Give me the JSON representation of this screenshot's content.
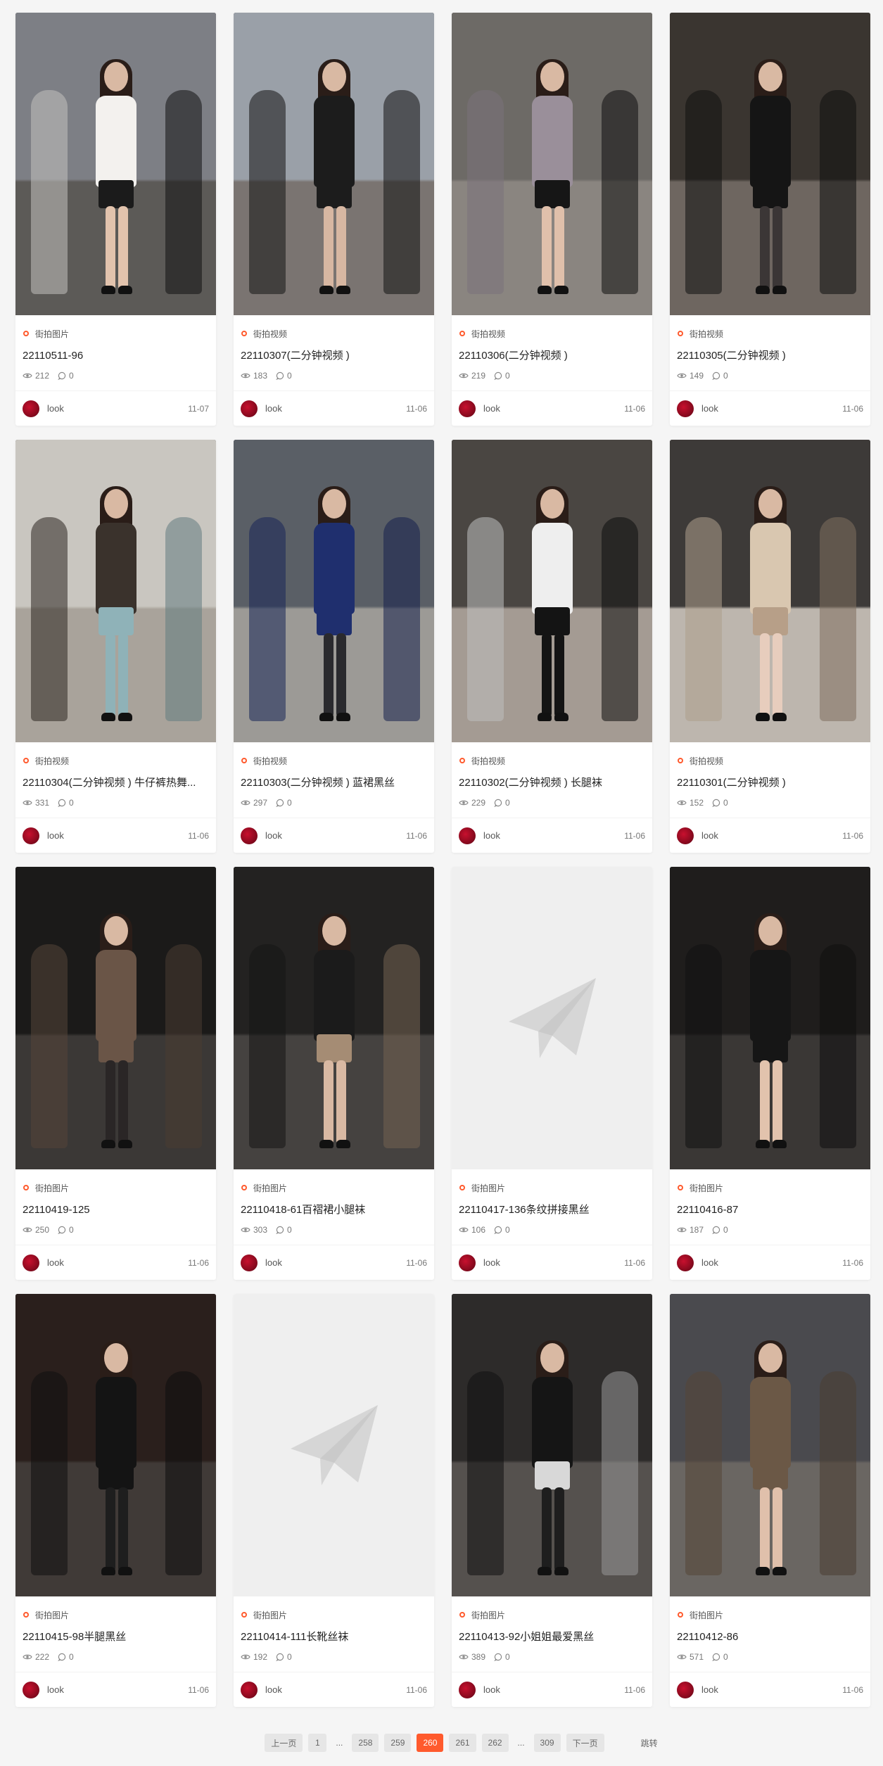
{
  "cards": [
    {
      "category": "街拍图片",
      "title": "22110511-96",
      "views": "212",
      "comments": "0",
      "author": "look",
      "date": "11-07",
      "placeholder": false,
      "palette": {
        "bg": "#7d7f85",
        "ground": "#5c5a57",
        "top": "#f3f1ee",
        "skirt": "#1b1b1b",
        "leg": "#e2c3ad"
      }
    },
    {
      "category": "街拍视频",
      "title": "22110307(二分钟视频 )",
      "views": "183",
      "comments": "0",
      "author": "look",
      "date": "11-06",
      "placeholder": false,
      "palette": {
        "bg": "#9aa0a8",
        "ground": "#7a7471",
        "top": "#1c1c1c",
        "skirt": "#1c1c1c",
        "leg": "#d7b7a2"
      }
    },
    {
      "category": "街拍视频",
      "title": "22110306(二分钟视频 )",
      "views": "219",
      "comments": "0",
      "author": "look",
      "date": "11-06",
      "placeholder": false,
      "palette": {
        "bg": "#6d6a66",
        "ground": "#8a8580",
        "top": "#9a8f9a",
        "skirt": "#161616",
        "leg": "#e0c0ab"
      }
    },
    {
      "category": "街拍视频",
      "title": "22110305(二分钟视频 )",
      "views": "149",
      "comments": "0",
      "author": "look",
      "date": "11-06",
      "placeholder": false,
      "palette": {
        "bg": "#3a3530",
        "ground": "#6e6660",
        "top": "#151515",
        "skirt": "#151515",
        "leg": "#3b3636"
      }
    },
    {
      "category": "街拍视频",
      "title": "22110304(二分钟视频 ) 牛仔裤热舞...",
      "views": "331",
      "comments": "0",
      "author": "look",
      "date": "11-06",
      "placeholder": false,
      "palette": {
        "bg": "#c9c6c0",
        "ground": "#a9a39b",
        "top": "#3a322c",
        "skirt": "#8fb2b8",
        "leg": "#8fb2b8"
      }
    },
    {
      "category": "街拍视频",
      "title": "22110303(二分钟视频 ) 蓝裙黑丝",
      "views": "297",
      "comments": "0",
      "author": "look",
      "date": "11-06",
      "placeholder": false,
      "palette": {
        "bg": "#5a5f66",
        "ground": "#9c9a96",
        "top": "#1f2f6e",
        "skirt": "#1f2f6e",
        "leg": "#2a2a2e"
      }
    },
    {
      "category": "街拍视频",
      "title": "22110302(二分钟视频 ) 长腿袜",
      "views": "229",
      "comments": "0",
      "author": "look",
      "date": "11-06",
      "placeholder": false,
      "palette": {
        "bg": "#4a4642",
        "ground": "#a49b93",
        "top": "#eeeeee",
        "skirt": "#141414",
        "leg": "#141414"
      }
    },
    {
      "category": "街拍视频",
      "title": "22110301(二分钟视频 )",
      "views": "152",
      "comments": "0",
      "author": "look",
      "date": "11-06",
      "placeholder": false,
      "palette": {
        "bg": "#3d3a38",
        "ground": "#bdb6ae",
        "top": "#d9c7b0",
        "skirt": "#b79f88",
        "leg": "#e7cdbd"
      }
    },
    {
      "category": "街拍图片",
      "title": "22110419-125",
      "views": "250",
      "comments": "0",
      "author": "look",
      "date": "11-06",
      "placeholder": false,
      "palette": {
        "bg": "#1b1a19",
        "ground": "#3b3836",
        "top": "#6a5547",
        "skirt": "#6a5547",
        "leg": "#2a2626"
      }
    },
    {
      "category": "街拍图片",
      "title": "22110418-61百褶裙小腿袜",
      "views": "303",
      "comments": "0",
      "author": "look",
      "date": "11-06",
      "placeholder": false,
      "palette": {
        "bg": "#232221",
        "ground": "#454240",
        "top": "#1b1b1b",
        "skirt": "#a58c74",
        "leg": "#d9b9a3"
      }
    },
    {
      "category": "街拍图片",
      "title": "22110417-136条纹拼接黑丝",
      "views": "106",
      "comments": "0",
      "author": "look",
      "date": "11-06",
      "placeholder": true,
      "palette": {
        "bg": "#efefef",
        "ground": "#efefef",
        "top": "#efefef",
        "skirt": "#efefef",
        "leg": "#efefef"
      }
    },
    {
      "category": "街拍图片",
      "title": "22110416-87",
      "views": "187",
      "comments": "0",
      "author": "look",
      "date": "11-06",
      "placeholder": false,
      "palette": {
        "bg": "#1f1d1c",
        "ground": "#3a3735",
        "top": "#161616",
        "skirt": "#161616",
        "leg": "#e2c3ad"
      }
    },
    {
      "category": "街拍图片",
      "title": "22110415-98半腿黑丝",
      "views": "222",
      "comments": "0",
      "author": "look",
      "date": "11-06",
      "placeholder": false,
      "palette": {
        "bg": "#2a1f1c",
        "ground": "#403a37",
        "top": "#141414",
        "skirt": "#141414",
        "leg": "#1e1e1e"
      }
    },
    {
      "category": "街拍图片",
      "title": "22110414-111长靴丝袜",
      "views": "192",
      "comments": "0",
      "author": "look",
      "date": "11-06",
      "placeholder": true,
      "palette": {
        "bg": "#efefef",
        "ground": "#efefef",
        "top": "#efefef",
        "skirt": "#efefef",
        "leg": "#efefef"
      }
    },
    {
      "category": "街拍图片",
      "title": "22110413-92小姐姐最爱黑丝",
      "views": "389",
      "comments": "0",
      "author": "look",
      "date": "11-06",
      "placeholder": false,
      "palette": {
        "bg": "#2d2b2a",
        "ground": "#55514e",
        "top": "#151515",
        "skirt": "#d8d8d8",
        "leg": "#1e1e1e"
      }
    },
    {
      "category": "街拍图片",
      "title": "22110412-86",
      "views": "571",
      "comments": "0",
      "author": "look",
      "date": "11-06",
      "placeholder": false,
      "palette": {
        "bg": "#4a4a4e",
        "ground": "#6a6662",
        "top": "#6b5846",
        "skirt": "#6b5846",
        "leg": "#e0c0ab"
      }
    }
  ],
  "pagination": {
    "prev": "上一页",
    "first": "1",
    "ellipsis1": "...",
    "p258": "258",
    "p259": "259",
    "current": "260",
    "p261": "261",
    "p262": "262",
    "ellipsis2": "...",
    "last": "309",
    "next": "下一页",
    "jump": "跳转"
  },
  "colors": {
    "accent": "#ff5a2d",
    "avatar": "#c8102e"
  },
  "icons": {
    "category": "circle-dot-icon",
    "views": "eye-icon",
    "comments": "comment-bubble-icon",
    "placeholder": "paper-plane-icon"
  }
}
